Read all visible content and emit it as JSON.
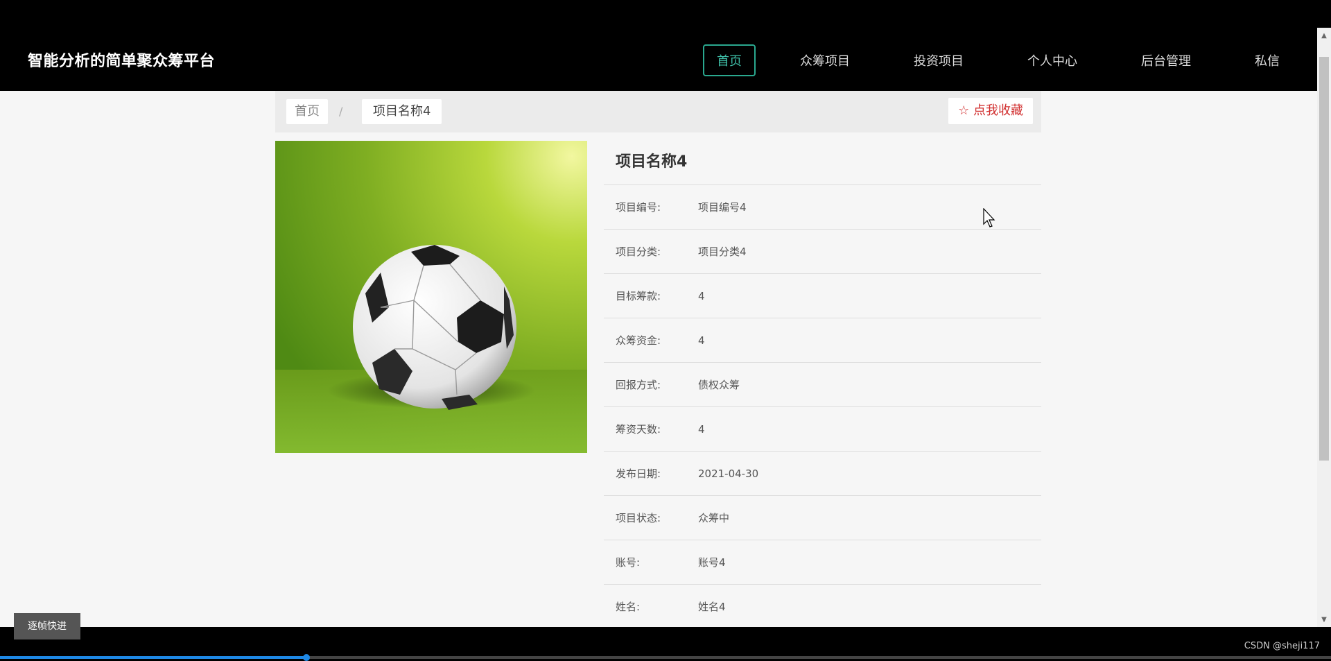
{
  "header": {
    "site_title": "智能分析的简单聚众筹平台",
    "nav": [
      {
        "label": "首页",
        "active": true
      },
      {
        "label": "众筹项目"
      },
      {
        "label": "投资项目"
      },
      {
        "label": "个人中心"
      },
      {
        "label": "后台管理"
      },
      {
        "label": "私信"
      }
    ]
  },
  "breadcrumb": {
    "home": "首页",
    "separator": "/",
    "current": "项目名称4"
  },
  "favorite_button": {
    "icon": "star-outline-icon",
    "label": "点我收藏",
    "color": "#d12f2f"
  },
  "photo": {
    "subject": "soccer-ball-image"
  },
  "detail": {
    "title": "项目名称4",
    "rows": [
      {
        "label": "项目编号:",
        "value": "项目编号4"
      },
      {
        "label": "项目分类:",
        "value": "项目分类4"
      },
      {
        "label": "目标筹款:",
        "value": "4"
      },
      {
        "label": "众筹资金:",
        "value": "4"
      },
      {
        "label": "回报方式:",
        "value": "债权众筹"
      },
      {
        "label": "筹资天数:",
        "value": "4"
      },
      {
        "label": "发布日期:",
        "value": "2021-04-30"
      },
      {
        "label": "项目状态:",
        "value": "众筹中"
      },
      {
        "label": "账号:",
        "value": "账号4"
      },
      {
        "label": "姓名:",
        "value": "姓名4"
      }
    ]
  },
  "player": {
    "frame_button": "逐帧快进",
    "watermark": "CSDN @sheji117",
    "progress": 0.23
  },
  "colors": {
    "accent": "#2aa88f",
    "header_bg": "#000000",
    "page_bg": "#f6f6f6"
  }
}
